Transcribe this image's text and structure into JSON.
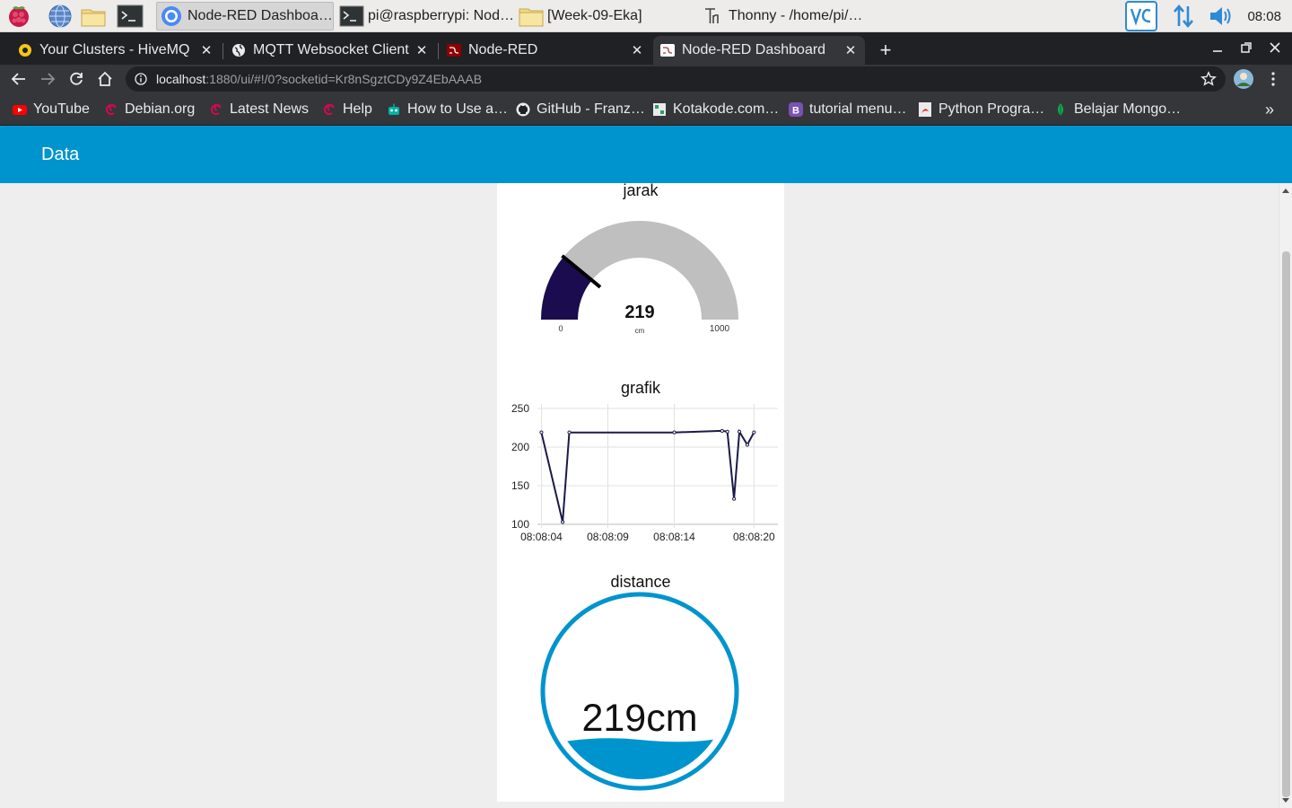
{
  "taskbar": {
    "tasks": [
      {
        "label": "Node-RED Dashboar…",
        "active": true
      },
      {
        "label": "pi@raspberrypi: Node…",
        "active": false
      },
      {
        "label": "[Week-09-Eka]",
        "active": false
      },
      {
        "label": "Thonny  -  /home/pi/…",
        "active": false
      }
    ],
    "clock": "08:08"
  },
  "browser": {
    "tabs": [
      {
        "title": "Your Clusters - HiveMQ C",
        "active": false
      },
      {
        "title": "MQTT Websocket Client",
        "active": false
      },
      {
        "title": "Node-RED",
        "active": false
      },
      {
        "title": "Node-RED Dashboard",
        "active": true
      }
    ],
    "new_tab": "+",
    "url_host": "localhost",
    "url_rest": ":1880/ui/#!/0?socketid=Kr8nSgztCDy9Z4EbAAAB",
    "bookmarks": [
      "YouTube",
      "Debian.org",
      "Latest News",
      "Help",
      "How to Use a…",
      "GitHub - Franz…",
      "Kotakode.com…",
      "tutorial menu…",
      "Python Progra…",
      "Belajar Mongo…"
    ],
    "bookmarks_more": "»"
  },
  "dashboard": {
    "title": "Data",
    "gauge": {
      "title": "jarak",
      "value": 219,
      "value_text": "219",
      "units": "cm",
      "min": 0,
      "max": 1000,
      "min_label": "0",
      "max_label": "1000",
      "fill_color": "#1b0c4f",
      "track_color": "#bfbfbf"
    },
    "liquid": {
      "title": "distance",
      "value_text": "219cm",
      "color": "#0094ce"
    }
  },
  "chart_data": {
    "type": "line",
    "title": "grafik",
    "xlabel": "",
    "ylabel": "",
    "x_ticks": [
      "08:08:04",
      "08:08:09",
      "08:08:14",
      "08:08:20"
    ],
    "y_ticks": [
      "250",
      "200",
      "150",
      "100"
    ],
    "ylim": [
      100,
      250
    ],
    "xlim": [
      "08:08:03.7",
      "08:08:21.8"
    ],
    "grid": true,
    "legend": "none",
    "series": [
      {
        "color": "#1b1a4a",
        "points": [
          {
            "x": "08:08:04.0",
            "y": 219
          },
          {
            "x": "08:08:05.6",
            "y": 103
          },
          {
            "x": "08:08:06.1",
            "y": 219
          },
          {
            "x": "08:08:14.0",
            "y": 219
          },
          {
            "x": "08:08:17.6",
            "y": 221
          },
          {
            "x": "08:08:18.0",
            "y": 220
          },
          {
            "x": "08:08:18.5",
            "y": 133
          },
          {
            "x": "08:08:18.9",
            "y": 220
          },
          {
            "x": "08:08:19.5",
            "y": 203
          },
          {
            "x": "08:08:20.0",
            "y": 219
          }
        ]
      }
    ]
  }
}
